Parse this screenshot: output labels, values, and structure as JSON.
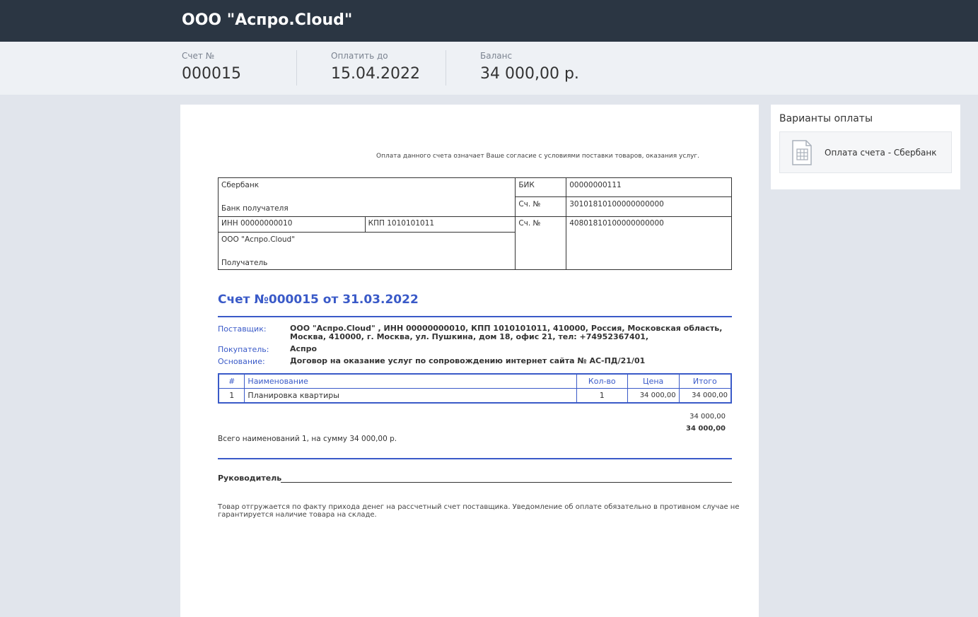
{
  "header": {
    "title": "ООО \"Аспро.Cloud\""
  },
  "info": {
    "invoice": {
      "label": "Счет №",
      "value": "000015"
    },
    "due": {
      "label": "Оплатить до",
      "value": "15.04.2022"
    },
    "balance": {
      "label": "Баланс",
      "value": "34 000,00 р."
    }
  },
  "document": {
    "consent": "Оплата данного счета означает Ваше согласие с условиями поставки товаров, оказания услуг.",
    "bank": {
      "name": "Сбербанк",
      "bank_label": "Банк получателя",
      "bik_label": "БИК",
      "bik": "00000000111",
      "corr_label": "Сч. №",
      "corr": "30101810100000000000",
      "inn": "ИНН 00000000010",
      "kpp": "КПП 1010101011",
      "acc_label": "Сч. №",
      "acc": "40801810100000000000",
      "recipient": "ООО \"Аспро.Cloud\"",
      "recipient_label": "Получатель"
    },
    "title": "Счет №000015 от 31.03.2022",
    "supplier_label": "Поставщик:",
    "supplier": "ООО \"Аспро.Cloud\" , ИНН 00000000010, КПП 1010101011, 410000, Россия, Московская область, Москва, 410000, г. Москва, ул. Пушкина, дом 18, офис 21, тел: +74952367401,",
    "buyer_label": "Покупатель:",
    "buyer": "Аспро",
    "basis_label": "Основание:",
    "basis": "Договор на оказание услуг по сопровождению интернет сайта № АС-ПД/21/01",
    "table": {
      "headers": {
        "num": "#",
        "name": "Наименование",
        "qty": "Кол-во",
        "price": "Цена",
        "total": "Итого"
      },
      "rows": [
        {
          "num": "1",
          "name": "Планировка квартиры",
          "qty": "1",
          "price": "34 000,00",
          "total": "34 000,00"
        }
      ]
    },
    "subtotal": "34 000,00",
    "grand_total": "34 000,00",
    "summary": "Всего наименований 1, на сумму 34 000,00 р.",
    "signer_label": "Руководитель",
    "note": "Товар отгружается по факту прихода денег на рассчетный счет поставщика. Уведомление об оплате обязательно в противном случае не гарантируется наличие товара на складе."
  },
  "payment": {
    "heading": "Варианты оплаты",
    "options": [
      {
        "label": "Оплата счета - Сбербанк",
        "icon": "invoice-document-icon"
      }
    ]
  },
  "colors": {
    "topbar": "#2b3643",
    "accent": "#3a5ac8",
    "infobar": "#eef1f5",
    "background": "#e1e5ec"
  }
}
